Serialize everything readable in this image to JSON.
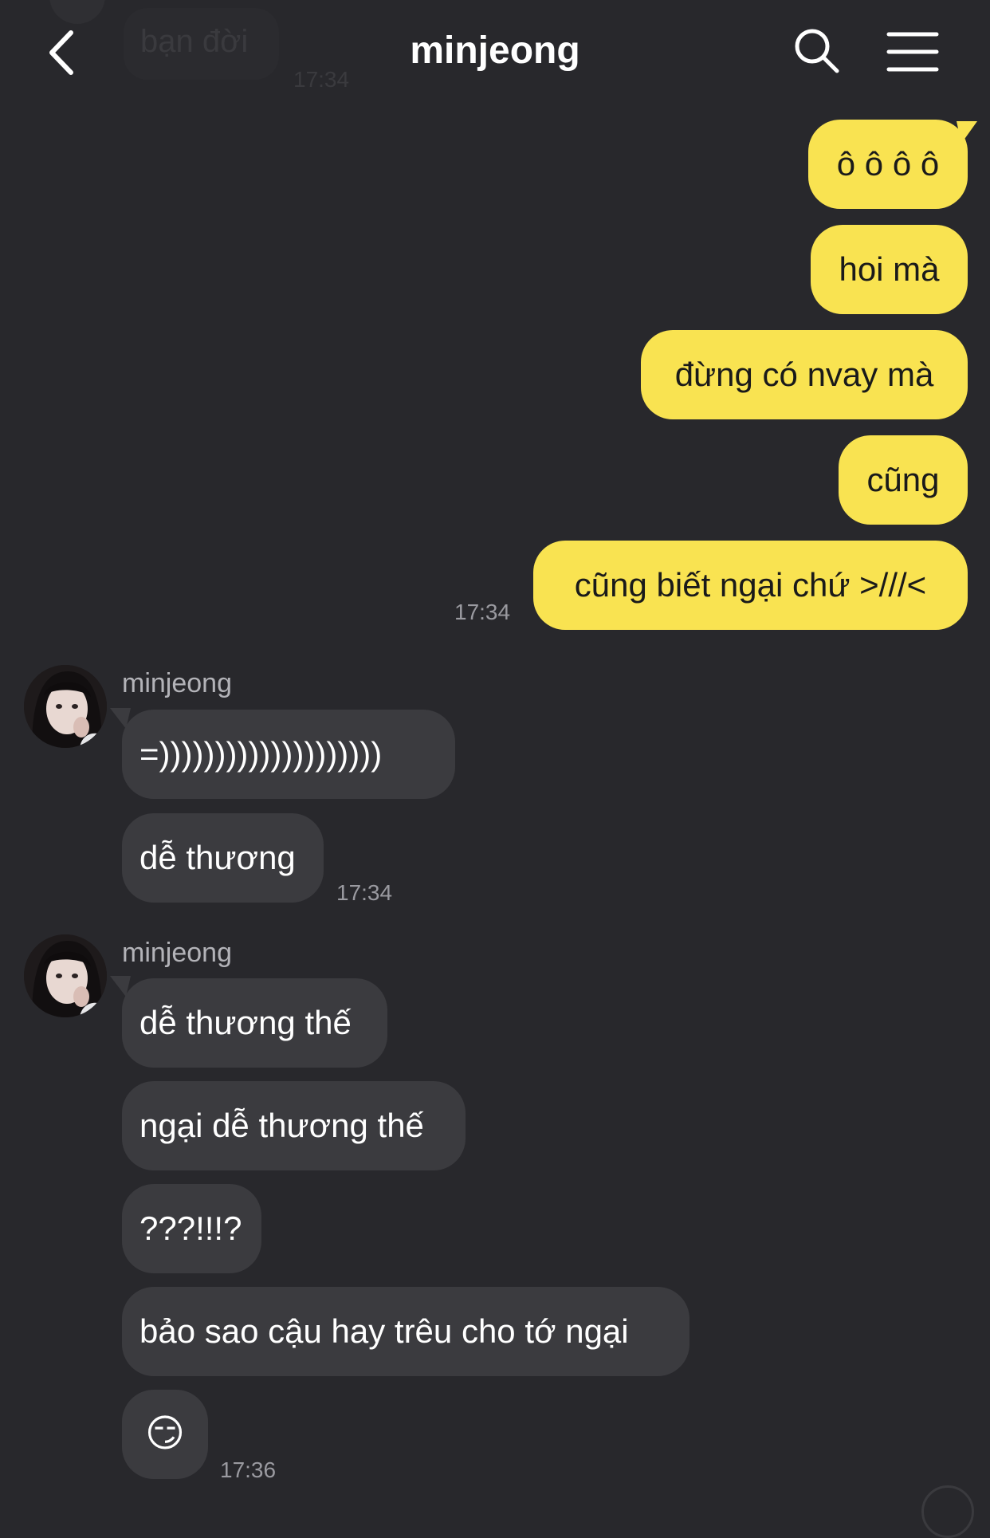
{
  "header": {
    "title": "minjeong",
    "back_icon": "chevron-left-icon",
    "search_icon": "search-icon",
    "menu_icon": "hamburger-menu-icon"
  },
  "scrolled_message": {
    "text": "bạn đời",
    "time": "17:34"
  },
  "my_messages": [
    {
      "text": "ô ô ô ô"
    },
    {
      "text": "hoi mà"
    },
    {
      "text": "đừng có nvay mà"
    },
    {
      "text": "cũng"
    },
    {
      "text": "cũng biết ngại chứ >///<"
    }
  ],
  "my_messages_time": "17:34",
  "groups": [
    {
      "sender": "minjeong",
      "messages": [
        {
          "text": "=))))))))))))))))))))"
        },
        {
          "text": "dễ thương"
        }
      ],
      "time": "17:34"
    },
    {
      "sender": "minjeong",
      "messages": [
        {
          "text": "dễ thương thế"
        },
        {
          "text": "ngại dễ thương thế"
        },
        {
          "text": "???!!!?"
        },
        {
          "text": "bảo sao cậu hay trêu cho tớ ngại"
        },
        {
          "text": "😏"
        }
      ],
      "time": "17:36"
    }
  ],
  "colors": {
    "background": "#28282c",
    "my_bubble": "#f9e351",
    "their_bubble": "#3b3b3f",
    "timestamp": "#9a9aa0"
  }
}
